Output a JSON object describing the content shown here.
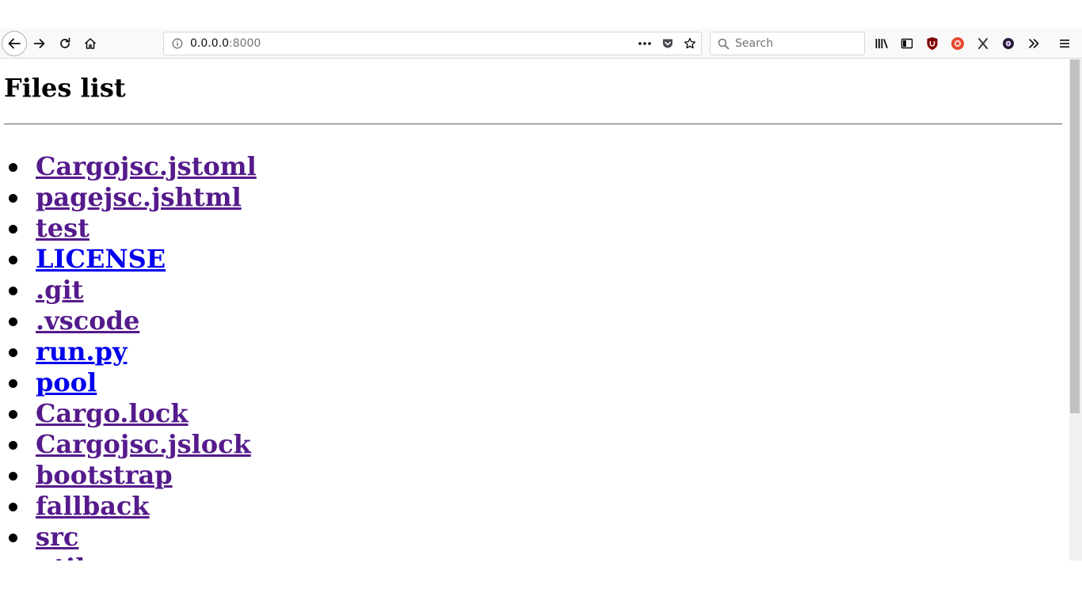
{
  "browser": {
    "url_host": "0.0.0.0",
    "url_port": ":8000",
    "search_placeholder": "Search"
  },
  "page": {
    "title": "Files list",
    "files": [
      {
        "name": "Cargojsc.jstoml",
        "visited": true
      },
      {
        "name": "pagejsc.jshtml",
        "visited": true
      },
      {
        "name": "test",
        "visited": true
      },
      {
        "name": "LICENSE",
        "visited": false
      },
      {
        "name": ".git",
        "visited": true
      },
      {
        "name": ".vscode",
        "visited": true
      },
      {
        "name": "run.py",
        "visited": false
      },
      {
        "name": "pool",
        "visited": false
      },
      {
        "name": "Cargo.lock",
        "visited": true
      },
      {
        "name": "Cargojsc.jslock",
        "visited": true
      },
      {
        "name": "bootstrap",
        "visited": true
      },
      {
        "name": "fallback",
        "visited": true
      },
      {
        "name": "src",
        "visited": true
      },
      {
        "name": "util",
        "visited": true
      }
    ]
  },
  "colors": {
    "link": "#0000ee",
    "visited_link": "#551a8b"
  }
}
